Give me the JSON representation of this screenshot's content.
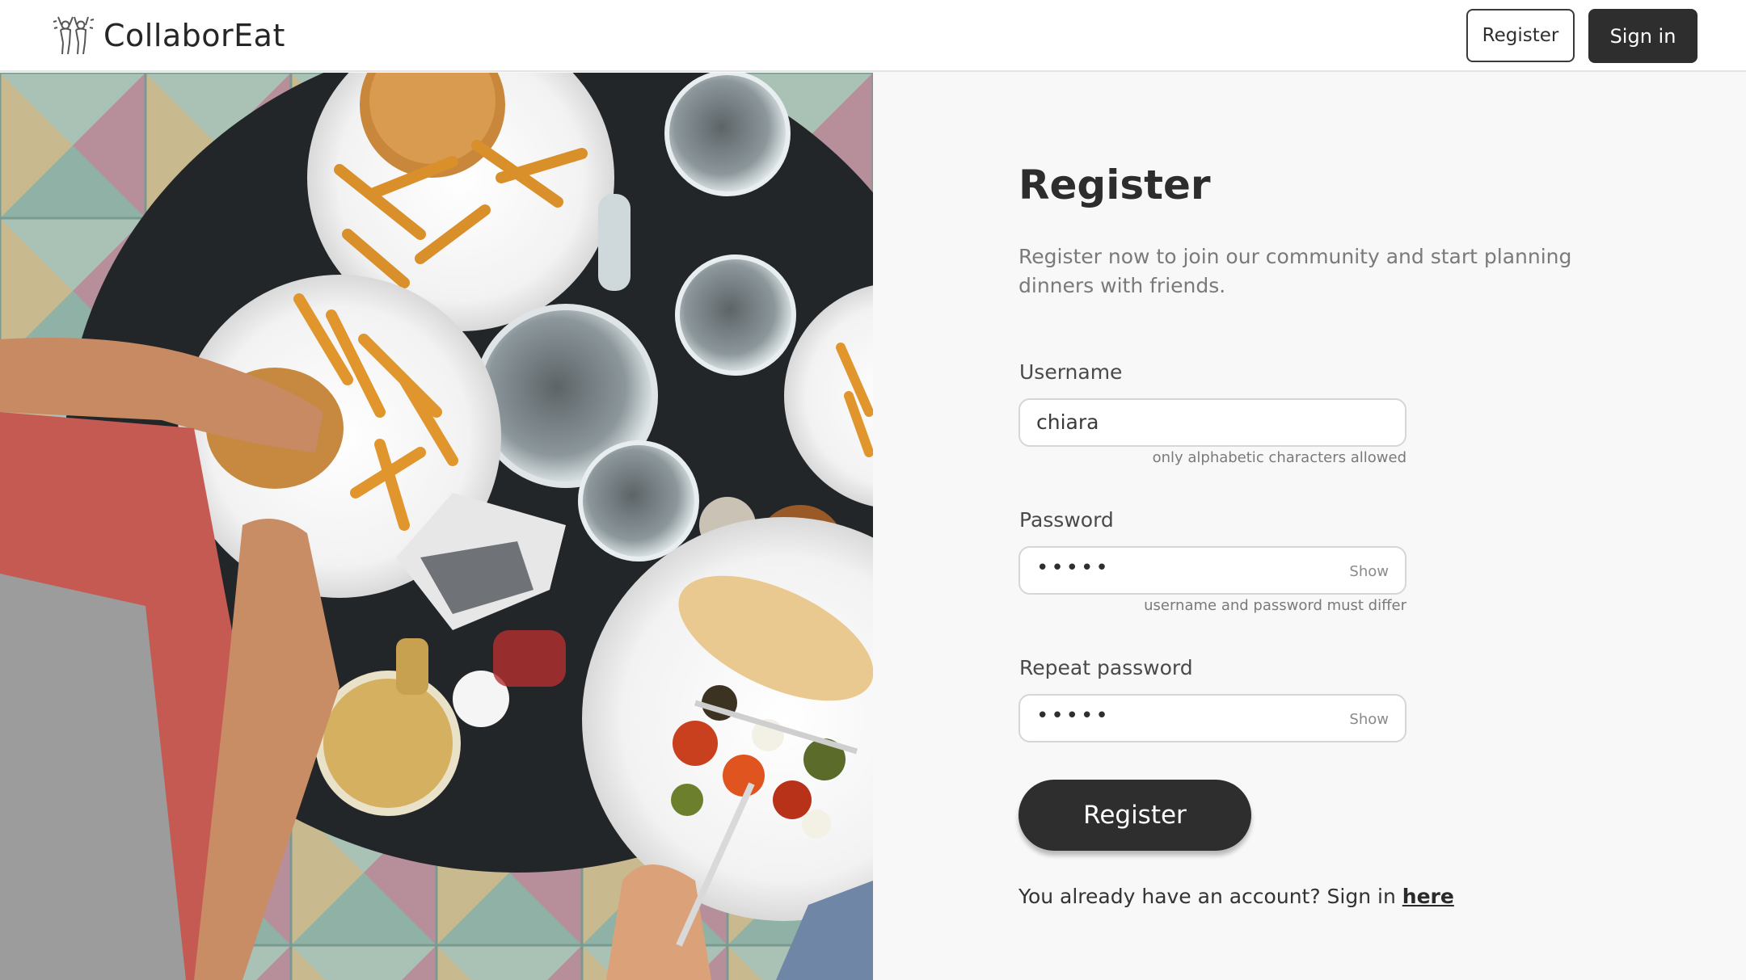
{
  "header": {
    "brand": "CollaborEat",
    "register_label": "Register",
    "signin_label": "Sign in"
  },
  "form": {
    "title": "Register",
    "subtitle": "Register now to join our community and start planning dinners with friends.",
    "username": {
      "label": "Username",
      "value": "chiara",
      "hint": "only alphabetic characters allowed"
    },
    "password": {
      "label": "Password",
      "value_masked": "•••••",
      "toggle": "Show",
      "hint": "username and password must differ"
    },
    "repeat_password": {
      "label": "Repeat password",
      "value_masked": "•••••",
      "toggle": "Show"
    },
    "submit_label": "Register",
    "signin_prompt": "You already have an account? Sign in",
    "signin_link": "here"
  },
  "colors": {
    "primary_dark": "#2e2e2e",
    "background": "#f8f8f8",
    "muted_text": "#7a7a7a"
  },
  "icons": {
    "logo": "people-cheering-icon"
  }
}
